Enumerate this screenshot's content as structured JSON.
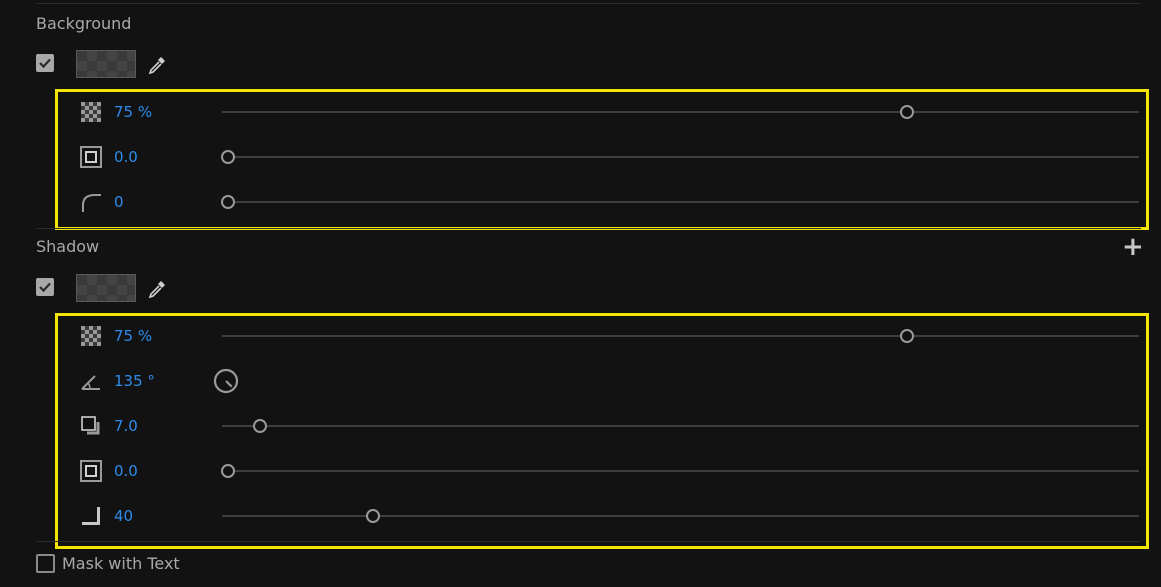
{
  "background": {
    "title": "Background",
    "enabled": true,
    "props": [
      {
        "icon": "opacity-icon",
        "value": "75",
        "unit": "%",
        "slider": 0.75
      },
      {
        "icon": "stroke-size-icon",
        "value": "0.0",
        "unit": "",
        "slider": 0.0
      },
      {
        "icon": "corner-radius-icon",
        "value": "0",
        "unit": "",
        "slider": 0.0
      }
    ]
  },
  "shadow": {
    "title": "Shadow",
    "enabled": true,
    "add_label": "+",
    "props": [
      {
        "icon": "opacity-icon",
        "value": "75",
        "unit": "%",
        "slider": 0.75
      },
      {
        "icon": "angle-icon",
        "value": "135",
        "unit": "°",
        "dial": true
      },
      {
        "icon": "distance-icon",
        "value": "7.0",
        "unit": "",
        "slider": 0.035
      },
      {
        "icon": "size-icon",
        "value": "0.0",
        "unit": "",
        "slider": 0.0
      },
      {
        "icon": "blur-icon",
        "value": "40",
        "unit": "",
        "slider": 0.16
      }
    ]
  },
  "mask": {
    "label": "Mask with Text",
    "checked": false
  },
  "colors": {
    "accent": "#2d8ceb",
    "highlight": "#f2e600",
    "background": "#121212"
  }
}
